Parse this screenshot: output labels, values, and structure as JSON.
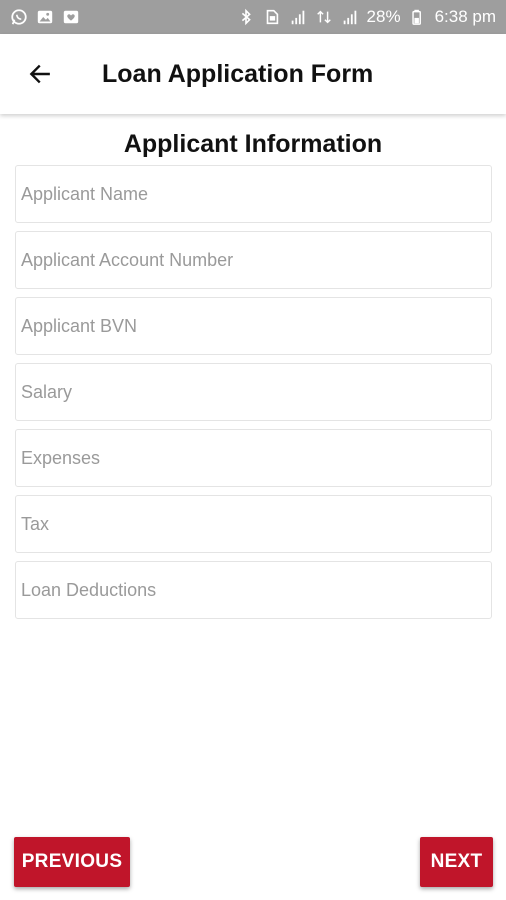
{
  "status_bar": {
    "left_icons": [
      "whatsapp-icon",
      "image-icon",
      "gallery-icon"
    ],
    "right_icons": [
      "bluetooth-icon",
      "sim-icon",
      "signal-icon",
      "data-icon",
      "signal-icon",
      "battery-icon"
    ],
    "battery": "28%",
    "time": "6:38 pm"
  },
  "app_bar": {
    "back_icon": "arrow-left-icon",
    "title": "Loan Application Form"
  },
  "section": {
    "title": "Applicant Information"
  },
  "fields": [
    {
      "placeholder": "Applicant Name",
      "value": ""
    },
    {
      "placeholder": "Applicant Account Number",
      "value": ""
    },
    {
      "placeholder": "Applicant BVN",
      "value": ""
    },
    {
      "placeholder": "Salary",
      "value": ""
    },
    {
      "placeholder": "Expenses",
      "value": ""
    },
    {
      "placeholder": "Tax",
      "value": ""
    },
    {
      "placeholder": "Loan Deductions",
      "value": ""
    }
  ],
  "buttons": {
    "previous": "PREVIOUS",
    "next": "NEXT"
  },
  "colors": {
    "status_bar": "#9e9e9e",
    "accent": "#c0152a",
    "field_border": "#e4e4e4",
    "placeholder": "#9a9a9a"
  }
}
